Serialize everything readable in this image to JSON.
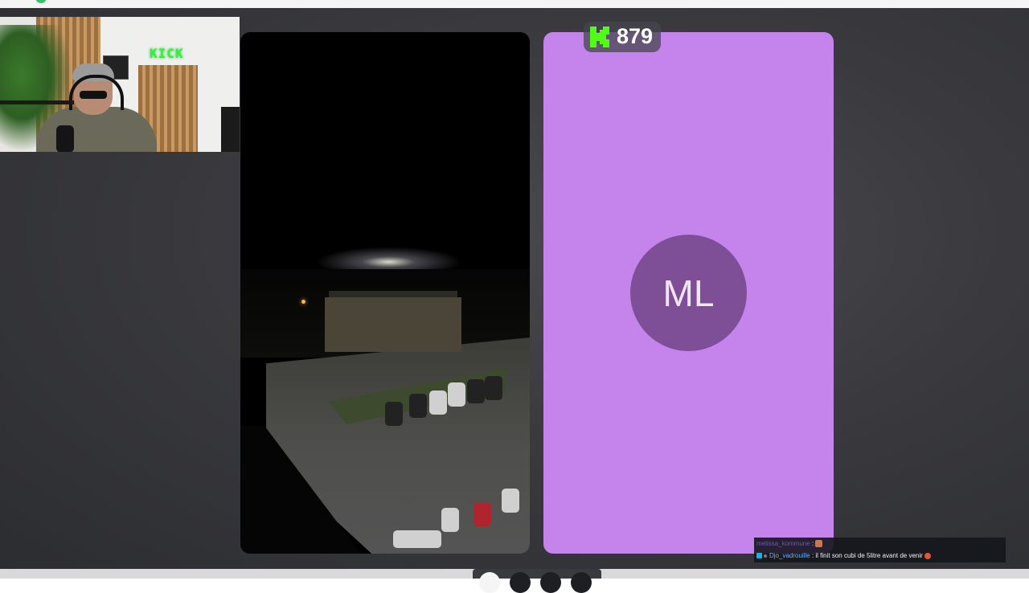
{
  "overlay": {
    "viewer_count": "879",
    "viewer_icon": "kick-logo-icon",
    "accent_color": "#53fc18"
  },
  "webcam": {
    "sign_text": "KICK"
  },
  "participant": {
    "initials": "ML",
    "tile_color": "#c584ec",
    "avatar_color": "#7e4f96"
  },
  "chat": {
    "messages": [
      {
        "user": "melissa_kommune",
        "separator": ":",
        "text": "",
        "emoji": "custom-emote"
      },
      {
        "user": "Djo_vadrouille",
        "separator": ":",
        "text": "il finit son cubi de 5litre avant de venir",
        "emoji": "face-emoji"
      }
    ]
  },
  "dock": {
    "buttons": [
      "dock-button-1",
      "dock-button-2",
      "dock-button-3",
      "dock-button-4"
    ]
  }
}
